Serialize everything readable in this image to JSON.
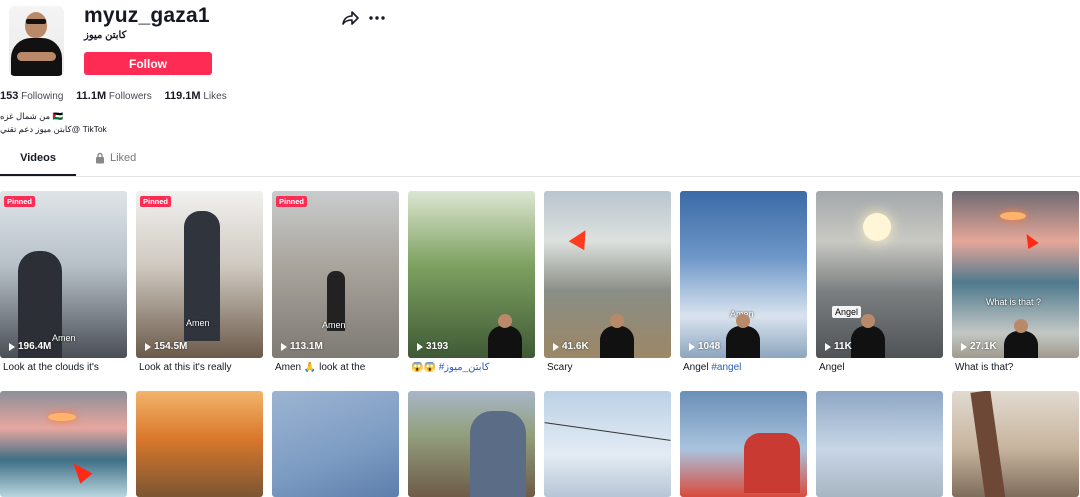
{
  "profile": {
    "username": "myuz_gaza1",
    "nickname": "كابتن ميوز",
    "follow_label": "Follow",
    "stats": {
      "following": "153",
      "following_label": "Following",
      "followers": "11.1M",
      "followers_label": "Followers",
      "likes": "119.1M",
      "likes_label": "Likes"
    },
    "bio_line1": "من شمال غزه 🇵🇸",
    "bio_line2": "كابتن ميوز دعم تقني@ TikTok"
  },
  "tabs": {
    "videos": "Videos",
    "liked": "Liked"
  },
  "videos": [
    {
      "pinned": "Pinned",
      "views": "196.4M",
      "caption": "Look at the clouds it's",
      "overlay": "Amen"
    },
    {
      "pinned": "Pinned",
      "views": "154.5M",
      "caption": "Look at this it's really",
      "overlay": "Amen"
    },
    {
      "pinned": "Pinned",
      "views": "113.1M",
      "caption": "Amen 🙏 look at the",
      "overlay": "Amen"
    },
    {
      "views": "3193",
      "caption_emoji": "😱😱",
      "caption_tag": "#كابتن_ميوز"
    },
    {
      "views": "41.6K",
      "caption": "Scary"
    },
    {
      "views": "1048",
      "caption": "Angel ",
      "caption_tag": "#angel",
      "overlay": "Amen"
    },
    {
      "views": "11K",
      "caption": "Angel",
      "overlay": "Angel"
    },
    {
      "views": "27.1K",
      "caption": "What is that?",
      "overlay": "What is that ?"
    }
  ],
  "colors": {
    "accent": "#fe2c55",
    "text": "#161823",
    "link": "#2b5db9"
  }
}
